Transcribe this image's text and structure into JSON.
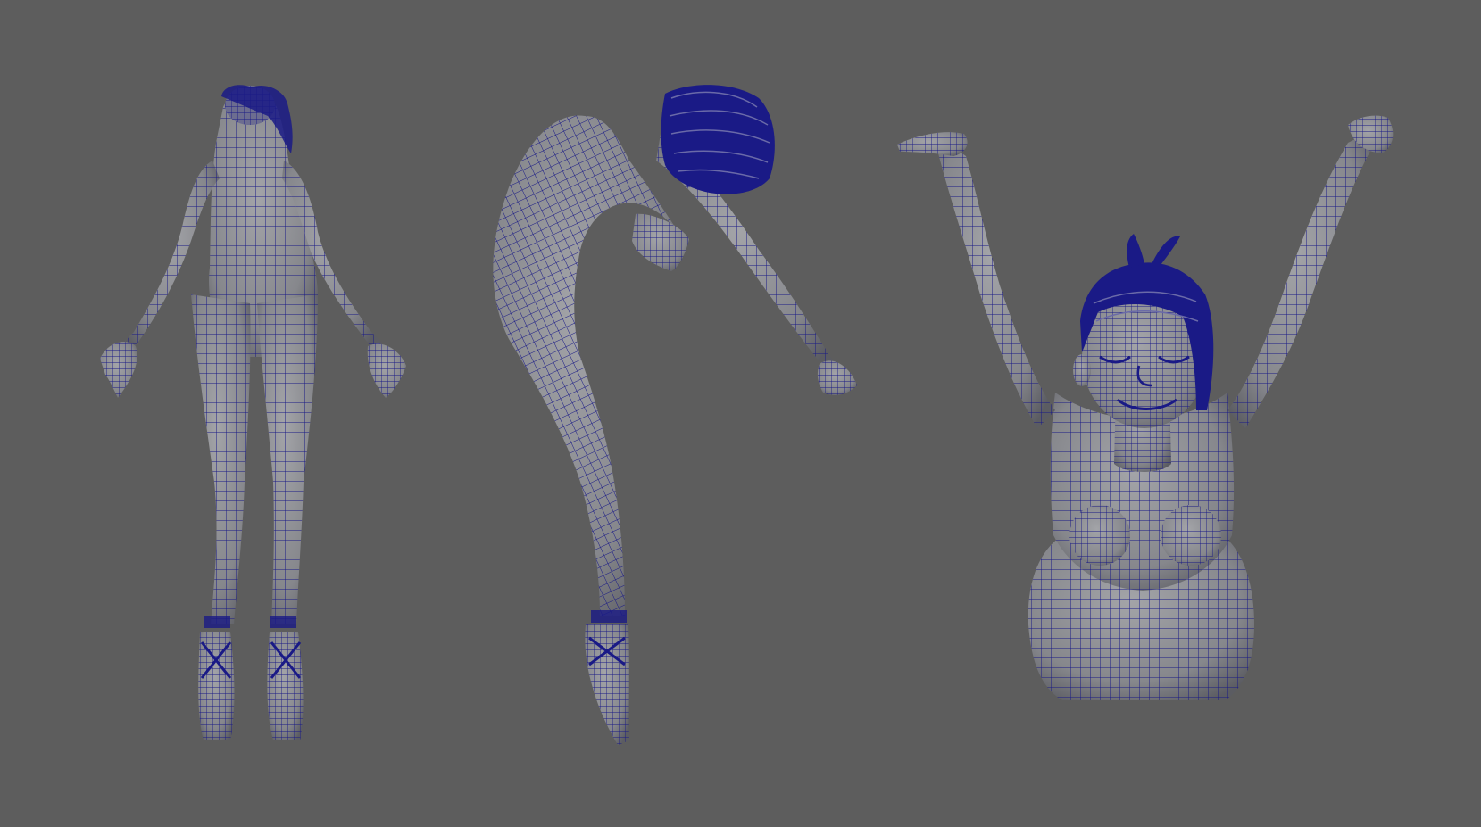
{
  "viewport": {
    "background": "#5d5d5d",
    "mesh_fill": "#8c8d92",
    "mesh_shade": "#6f7076",
    "wire_color": "#1a1a86",
    "hair_color": "#1a1a86"
  },
  "models": [
    {
      "pose": "standing-back-view"
    },
    {
      "pose": "arabesque-bend-side-view"
    },
    {
      "pose": "kneeling-arms-raised-front-view"
    }
  ]
}
